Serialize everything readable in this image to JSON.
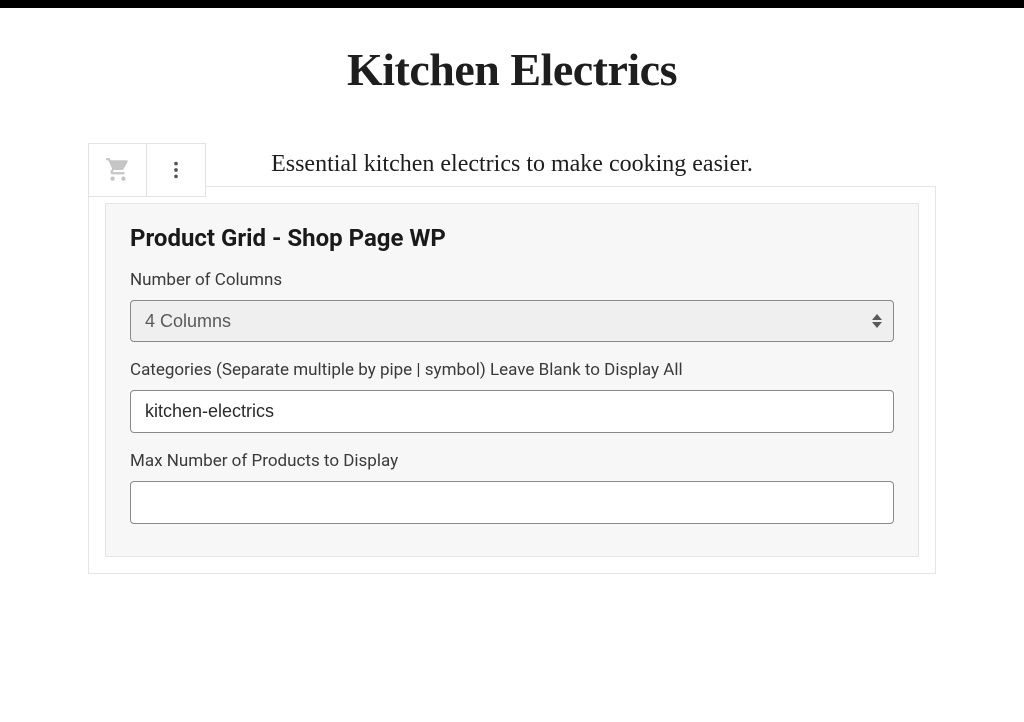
{
  "page": {
    "title": "Kitchen Electrics",
    "subtitle": "Essential kitchen electrics to make cooking easier."
  },
  "block": {
    "title": "Product Grid - Shop Page WP",
    "fields": {
      "columns": {
        "label": "Number of Columns",
        "value": "4 Columns"
      },
      "categories": {
        "label": "Categories (Separate multiple by pipe | symbol) Leave Blank to Display All",
        "value": "kitchen-electrics"
      },
      "max_products": {
        "label": "Max Number of Products to Display",
        "value": ""
      }
    }
  }
}
